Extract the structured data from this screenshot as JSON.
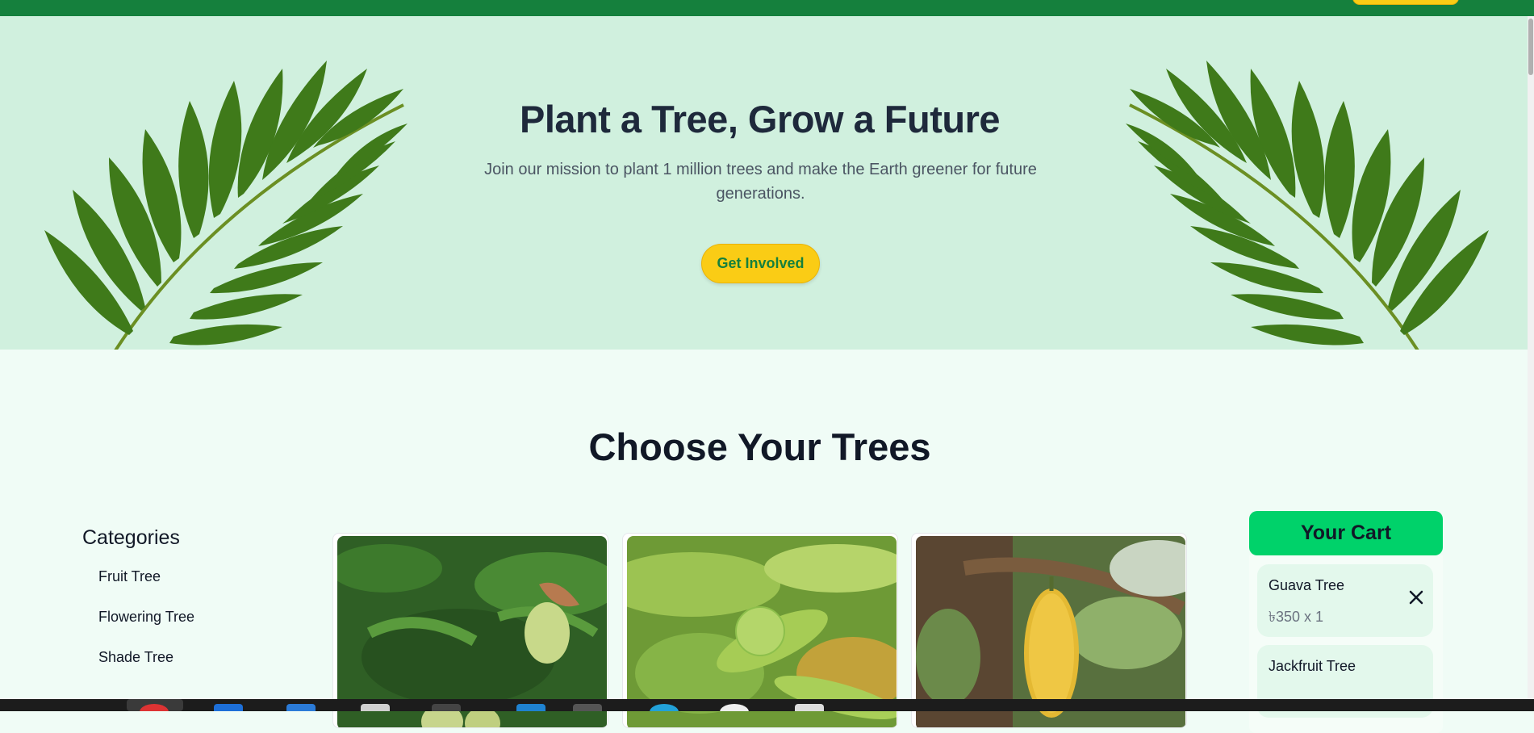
{
  "hero": {
    "title": "Plant a Tree, Grow a Future",
    "subtitle": "Join our mission to plant 1 million trees and make the Earth greener for future generations.",
    "cta_label": "Get Involved"
  },
  "trees_section": {
    "title": "Choose Your Trees"
  },
  "categories": {
    "heading": "Categories",
    "items": [
      "Fruit Tree",
      "Flowering Tree",
      "Shade Tree"
    ]
  },
  "cart": {
    "title": "Your Cart",
    "items": [
      {
        "name": "Guava Tree",
        "price": "৳350 x 1"
      },
      {
        "name": "Jackfruit Tree",
        "price": ""
      }
    ]
  },
  "products": [
    {
      "image": "mango-tree-image"
    },
    {
      "image": "guava-tree-image"
    },
    {
      "image": "jackfruit-tree-image"
    }
  ],
  "colors": {
    "nav_green": "#15803d",
    "hero_bg": "#d0f0de",
    "accent_yellow": "#facc15",
    "cart_header": "#00d26a",
    "page_bg": "#f0fcf6"
  }
}
